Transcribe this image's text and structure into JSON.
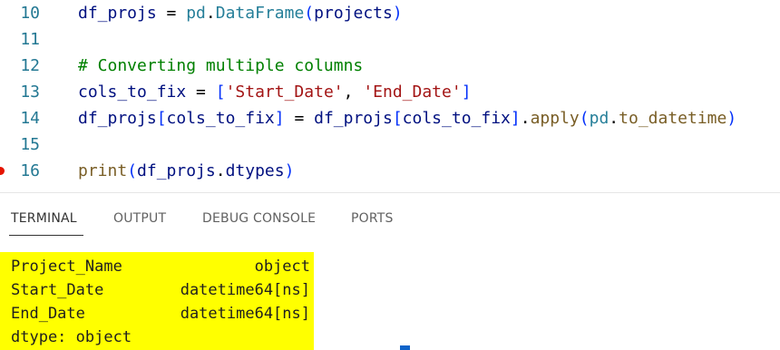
{
  "editor": {
    "lines": [
      {
        "num": "10",
        "tokens": [
          {
            "t": "df_projs",
            "c": "t-var"
          },
          {
            "t": " = ",
            "c": "t-op"
          },
          {
            "t": "pd",
            "c": "t-type"
          },
          {
            "t": ".",
            "c": "t-op"
          },
          {
            "t": "DataFrame",
            "c": "t-type"
          },
          {
            "t": "(",
            "c": "t-br1"
          },
          {
            "t": "projects",
            "c": "t-var"
          },
          {
            "t": ")",
            "c": "t-br1"
          }
        ]
      },
      {
        "num": "11",
        "tokens": []
      },
      {
        "num": "12",
        "tokens": [
          {
            "t": "# Converting multiple columns",
            "c": "t-cmt"
          }
        ]
      },
      {
        "num": "13",
        "tokens": [
          {
            "t": "cols_to_fix",
            "c": "t-var"
          },
          {
            "t": " = ",
            "c": "t-op"
          },
          {
            "t": "[",
            "c": "t-br1"
          },
          {
            "t": "'Start_Date'",
            "c": "t-str"
          },
          {
            "t": ", ",
            "c": "t-op"
          },
          {
            "t": "'End_Date'",
            "c": "t-str"
          },
          {
            "t": "]",
            "c": "t-br1"
          }
        ]
      },
      {
        "num": "14",
        "tokens": [
          {
            "t": "df_projs",
            "c": "t-var"
          },
          {
            "t": "[",
            "c": "t-br1"
          },
          {
            "t": "cols_to_fix",
            "c": "t-var"
          },
          {
            "t": "]",
            "c": "t-br1"
          },
          {
            "t": " = ",
            "c": "t-op"
          },
          {
            "t": "df_projs",
            "c": "t-var"
          },
          {
            "t": "[",
            "c": "t-br1"
          },
          {
            "t": "cols_to_fix",
            "c": "t-var"
          },
          {
            "t": "]",
            "c": "t-br1"
          },
          {
            "t": ".",
            "c": "t-op"
          },
          {
            "t": "apply",
            "c": "t-fn"
          },
          {
            "t": "(",
            "c": "t-br1"
          },
          {
            "t": "pd",
            "c": "t-type"
          },
          {
            "t": ".",
            "c": "t-op"
          },
          {
            "t": "to_datetime",
            "c": "t-fn"
          },
          {
            "t": ")",
            "c": "t-br1"
          }
        ]
      },
      {
        "num": "15",
        "tokens": []
      },
      {
        "num": "16",
        "breakpoint": true,
        "tokens": [
          {
            "t": "print",
            "c": "t-fn"
          },
          {
            "t": "(",
            "c": "t-br1"
          },
          {
            "t": "df_projs",
            "c": "t-var"
          },
          {
            "t": ".",
            "c": "t-op"
          },
          {
            "t": "dtypes",
            "c": "t-var"
          },
          {
            "t": ")",
            "c": "t-br1"
          }
        ]
      }
    ]
  },
  "panel": {
    "tabs": [
      {
        "label": "TERMINAL",
        "active": true
      },
      {
        "label": "OUTPUT",
        "active": false
      },
      {
        "label": "DEBUG CONSOLE",
        "active": false
      },
      {
        "label": "PORTS",
        "active": false
      }
    ]
  },
  "terminal": {
    "rows": [
      {
        "name": "Project_Name",
        "value": "object"
      },
      {
        "name": "Start_Date",
        "value": "datetime64[ns]"
      },
      {
        "name": "End_Date",
        "value": "datetime64[ns]"
      },
      {
        "name": "dtype: object",
        "value": ""
      }
    ]
  },
  "colors": {
    "highlight": "#ffff00",
    "line_number": "#237893",
    "comment": "#008000",
    "string": "#a31515",
    "function": "#795e26",
    "type": "#267f99",
    "variable": "#001080",
    "breakpoint": "#e51400",
    "cursor": "#0e63c9"
  }
}
